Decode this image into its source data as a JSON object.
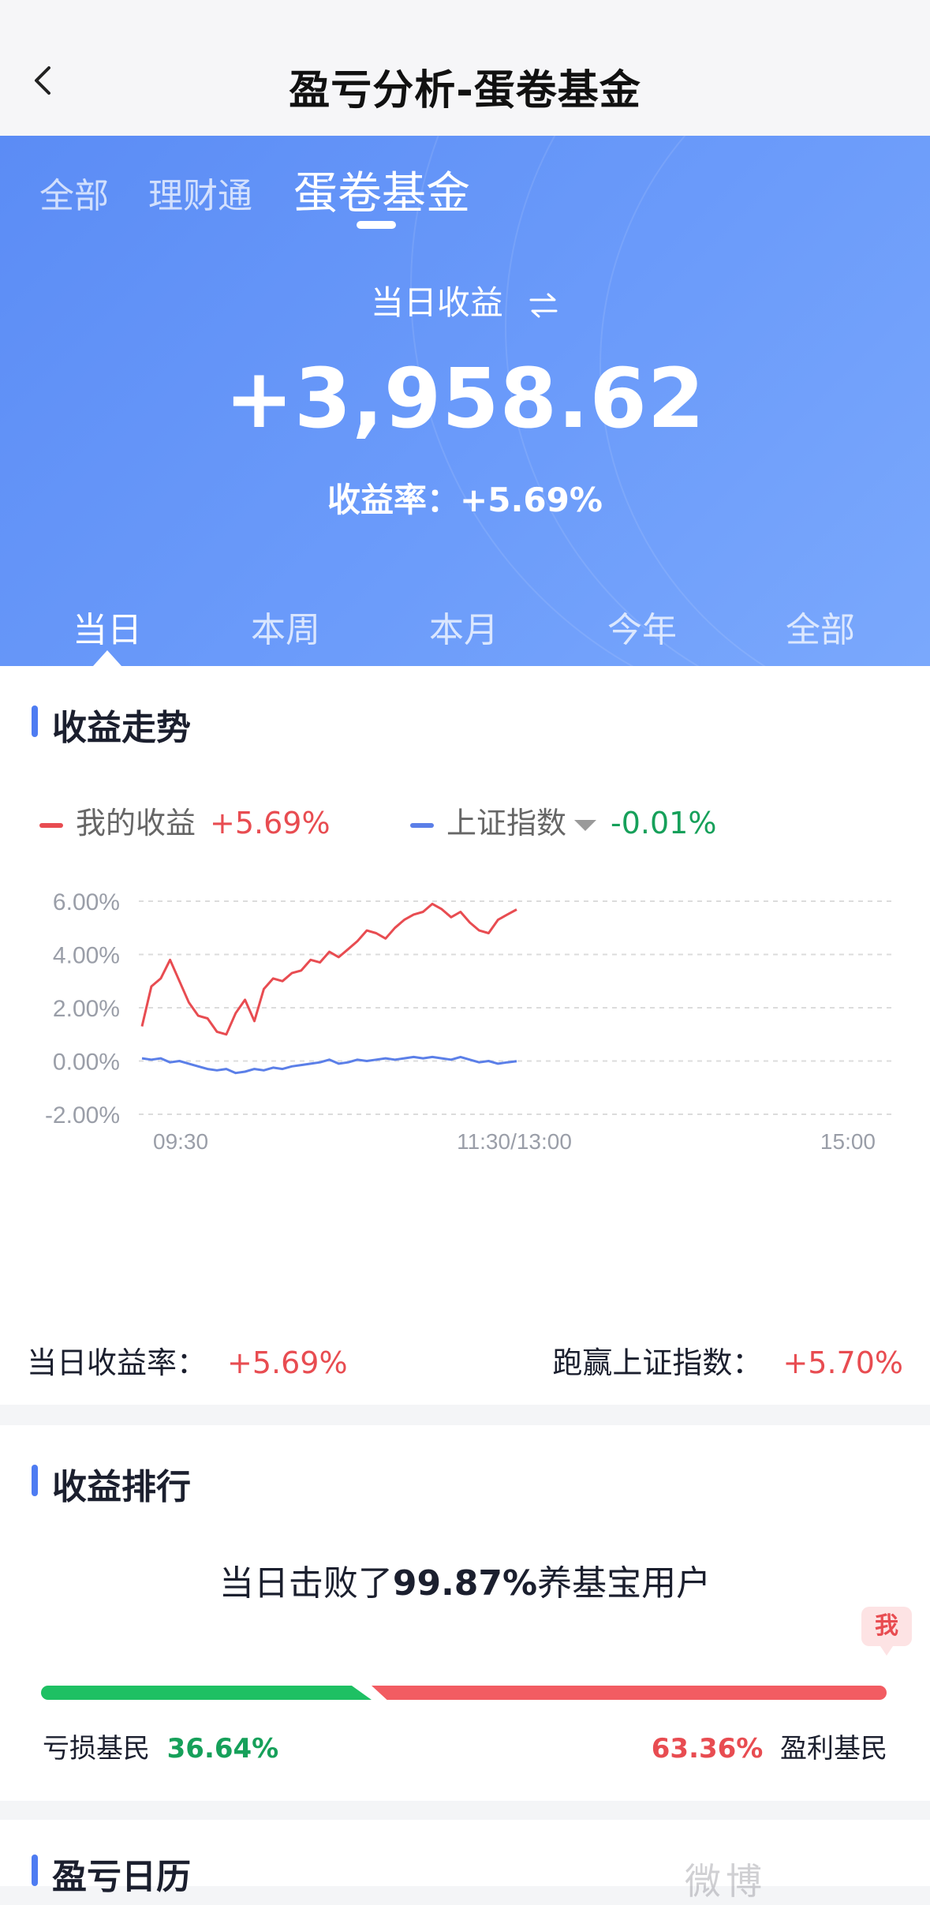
{
  "nav": {
    "title": "盈亏分析-蛋卷基金"
  },
  "source_tabs": [
    "全部",
    "理财通",
    "蛋卷基金"
  ],
  "header": {
    "daily_label": "当日收益",
    "amount": "+3,958.62",
    "rate_label": "收益率：",
    "rate_value": "+5.69%"
  },
  "period_tabs": [
    "当日",
    "本周",
    "本月",
    "今年",
    "全部"
  ],
  "trend": {
    "section_title": "收益走势",
    "legend": {
      "mine_label": "我的收益",
      "mine_value": "+5.69%",
      "index_label": "上证指数",
      "index_value": "-0.01%"
    },
    "summary_rate_label": "当日收益率：",
    "summary_rate_value": "+5.69%",
    "summary_beat_label": "跑赢上证指数：",
    "summary_beat_value": "+5.70%"
  },
  "chart_data": {
    "type": "line",
    "y_tick_labels": [
      "6.00%",
      "4.00%",
      "2.00%",
      "0.00%",
      "-2.00%"
    ],
    "x_tick_labels": [
      "09:30",
      "11:30/13:00",
      "15:00"
    ],
    "ylim": [
      -2,
      6
    ],
    "grid": true,
    "x_domain": [
      0,
      240
    ],
    "series": [
      {
        "name": "我的收益",
        "color": "#e84c51",
        "x": [
          0,
          3,
          6,
          9,
          12,
          15,
          18,
          21,
          24,
          27,
          30,
          33,
          36,
          39,
          42,
          45,
          48,
          51,
          54,
          57,
          60,
          63,
          66,
          69,
          72,
          75,
          78,
          81,
          84,
          87,
          90,
          93,
          96,
          99,
          102,
          105,
          108,
          111,
          114,
          117,
          120
        ],
        "values": [
          1.3,
          2.8,
          3.1,
          3.8,
          3.0,
          2.2,
          1.7,
          1.6,
          1.1,
          1.0,
          1.8,
          2.3,
          1.5,
          2.7,
          3.1,
          3.0,
          3.3,
          3.4,
          3.8,
          3.7,
          4.1,
          3.9,
          4.2,
          4.5,
          4.9,
          4.8,
          4.6,
          5.0,
          5.3,
          5.5,
          5.6,
          5.9,
          5.7,
          5.4,
          5.6,
          5.2,
          4.9,
          4.8,
          5.3,
          5.5,
          5.69
        ]
      },
      {
        "name": "上证指数",
        "color": "#5b7fe8",
        "x": [
          0,
          3,
          6,
          9,
          12,
          15,
          18,
          21,
          24,
          27,
          30,
          33,
          36,
          39,
          42,
          45,
          48,
          51,
          54,
          57,
          60,
          63,
          66,
          69,
          72,
          75,
          78,
          81,
          84,
          87,
          90,
          93,
          96,
          99,
          102,
          105,
          108,
          111,
          114,
          117,
          120
        ],
        "values": [
          0.1,
          0.05,
          0.1,
          -0.05,
          0.0,
          -0.1,
          -0.2,
          -0.3,
          -0.35,
          -0.3,
          -0.45,
          -0.4,
          -0.3,
          -0.35,
          -0.25,
          -0.3,
          -0.2,
          -0.15,
          -0.1,
          -0.05,
          0.05,
          -0.1,
          -0.05,
          0.05,
          0.0,
          0.05,
          0.1,
          0.05,
          0.1,
          0.15,
          0.1,
          0.15,
          0.1,
          0.05,
          0.15,
          0.05,
          -0.05,
          0.0,
          -0.1,
          -0.05,
          -0.01
        ]
      }
    ]
  },
  "ranking": {
    "section_title": "收益排行",
    "headline_prefix": "当日击败了",
    "headline_pct": "99.87%",
    "headline_suffix": "养基宝用户",
    "me_badge": "我",
    "loss_label": "亏损基民",
    "loss_pct": "36.64%",
    "profit_pct": "63.36%",
    "profit_label": "盈利基民",
    "loss_share": 0.3664,
    "loss_color": "#1ec063",
    "profit_color": "#f25c62"
  },
  "calendar": {
    "section_title": "盈亏日历"
  },
  "watermark": "微博"
}
